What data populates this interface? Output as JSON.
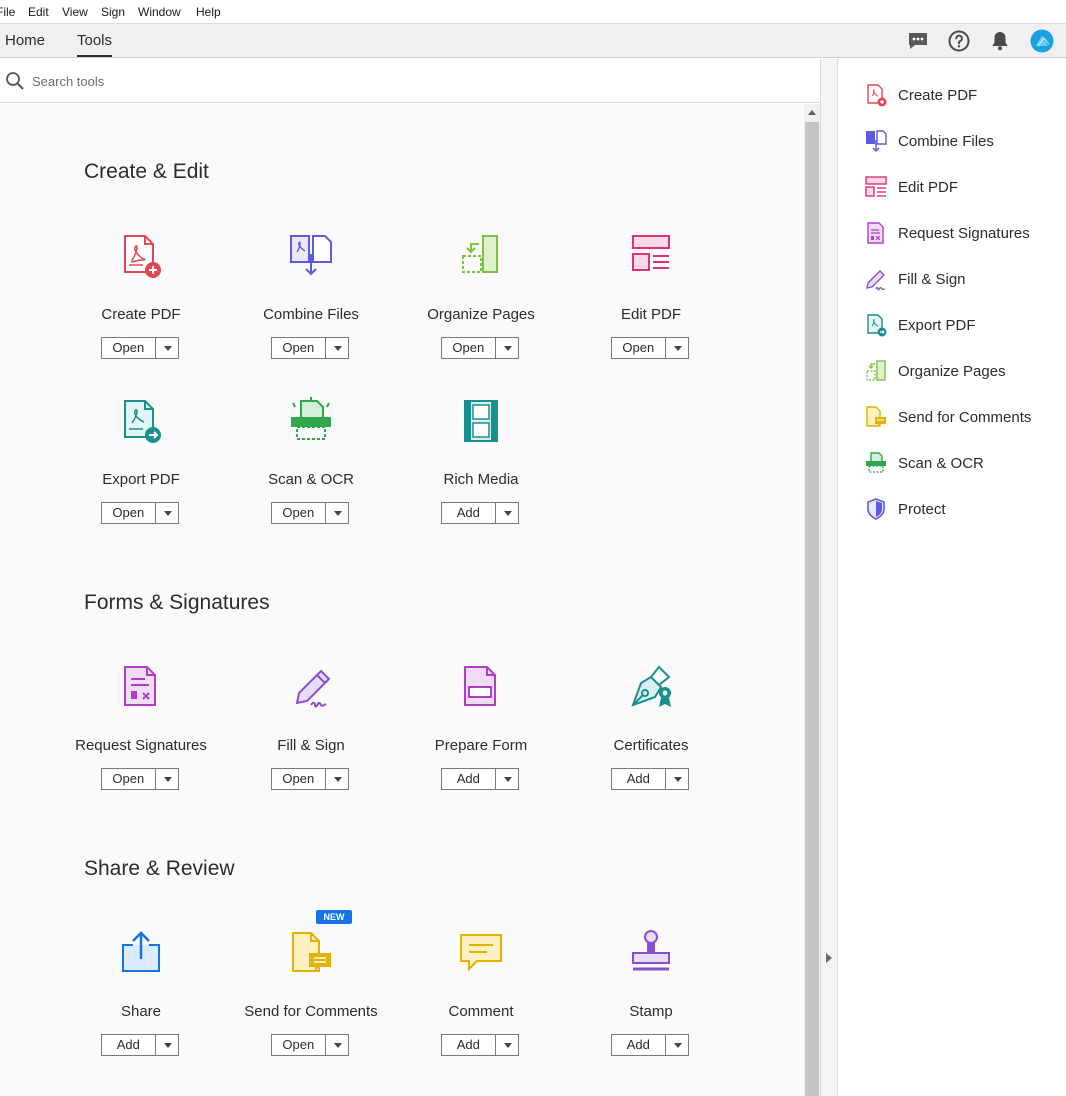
{
  "menu": [
    "File",
    "Edit",
    "View",
    "Sign",
    "Window",
    "Help"
  ],
  "tabs": {
    "home": "Home",
    "tools": "Tools"
  },
  "search": {
    "placeholder": "Search tools"
  },
  "sections": [
    {
      "title": "Create & Edit",
      "tools": [
        {
          "name": "Create PDF",
          "action": "Open",
          "icon": "create-pdf-icon",
          "color": "#e34850"
        },
        {
          "name": "Combine Files",
          "action": "Open",
          "icon": "combine-files-icon",
          "color": "#5c5ce0"
        },
        {
          "name": "Organize Pages",
          "action": "Open",
          "icon": "organize-pages-icon",
          "color": "#7fc241"
        },
        {
          "name": "Edit PDF",
          "action": "Open",
          "icon": "edit-pdf-icon",
          "color": "#e0307a"
        },
        {
          "name": "Export PDF",
          "action": "Open",
          "icon": "export-pdf-icon",
          "color": "#1a8f8f"
        },
        {
          "name": "Scan & OCR",
          "action": "Open",
          "icon": "scan-ocr-icon",
          "color": "#2ea84a"
        },
        {
          "name": "Rich Media",
          "action": "Add",
          "icon": "rich-media-icon",
          "color": "#1a8f8f"
        }
      ]
    },
    {
      "title": "Forms & Signatures",
      "tools": [
        {
          "name": "Request Signatures",
          "action": "Open",
          "icon": "request-signatures-icon",
          "color": "#b03fc6"
        },
        {
          "name": "Fill & Sign",
          "action": "Open",
          "icon": "fill-sign-icon",
          "color": "#8a4fd0"
        },
        {
          "name": "Prepare Form",
          "action": "Add",
          "icon": "prepare-form-icon",
          "color": "#b03fc6"
        },
        {
          "name": "Certificates",
          "action": "Add",
          "icon": "certificates-icon",
          "color": "#1a8f8f"
        }
      ]
    },
    {
      "title": "Share & Review",
      "tools": [
        {
          "name": "Share",
          "action": "Add",
          "icon": "share-icon",
          "color": "#1473e6"
        },
        {
          "name": "Send for Comments",
          "action": "Open",
          "icon": "send-for-comments-icon",
          "color": "#e0b400",
          "badge": "NEW"
        },
        {
          "name": "Comment",
          "action": "Add",
          "icon": "comment-icon",
          "color": "#e0b400"
        },
        {
          "name": "Stamp",
          "action": "Add",
          "icon": "stamp-icon",
          "color": "#8a4fd0"
        }
      ]
    }
  ],
  "right_panel": [
    {
      "label": "Create PDF",
      "icon": "create-pdf-icon"
    },
    {
      "label": "Combine Files",
      "icon": "combine-files-icon"
    },
    {
      "label": "Edit PDF",
      "icon": "edit-pdf-icon"
    },
    {
      "label": "Request Signatures",
      "icon": "request-signatures-icon"
    },
    {
      "label": "Fill & Sign",
      "icon": "fill-sign-icon"
    },
    {
      "label": "Export PDF",
      "icon": "export-pdf-icon"
    },
    {
      "label": "Organize Pages",
      "icon": "organize-pages-icon"
    },
    {
      "label": "Send for Comments",
      "icon": "send-for-comments-icon"
    },
    {
      "label": "Scan & OCR",
      "icon": "scan-ocr-icon"
    },
    {
      "label": "Protect",
      "icon": "protect-icon"
    }
  ]
}
